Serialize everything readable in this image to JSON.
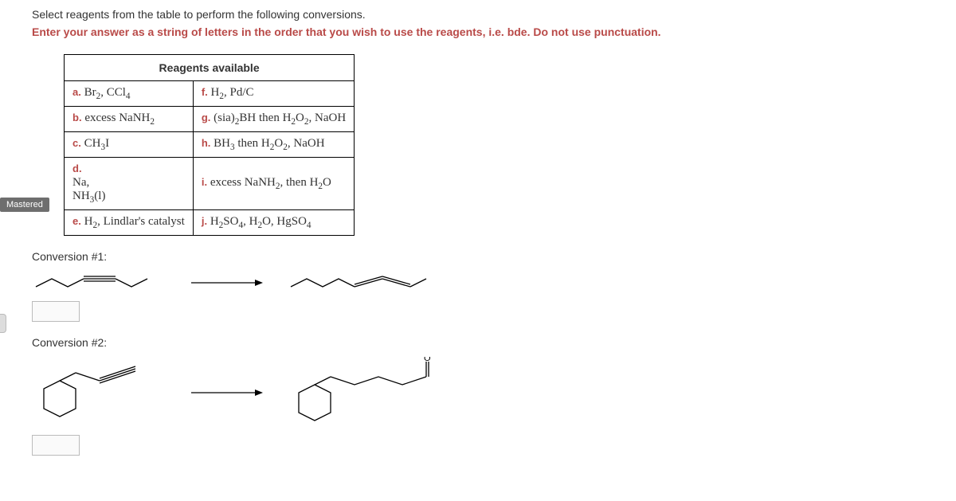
{
  "instructions": {
    "line1": "Select reagents from the table to perform the following conversions.",
    "line2": "Enter your answer as a string of letters in the order that you wish to use the reagents, i.e. bde. Do not use punctuation."
  },
  "table": {
    "header": "Reagents available",
    "rows": [
      {
        "left_label": "a.",
        "left_text": "Br₂, CCl₄",
        "right_label": "f.",
        "right_text": "H₂, Pd/C"
      },
      {
        "left_label": "b.",
        "left_text": "excess NaNH₂",
        "right_label": "g.",
        "right_text": "(sia)₂BH then H₂O₂, NaOH"
      },
      {
        "left_label": "c.",
        "left_text": "CH₃I",
        "right_label": "h.",
        "right_text": "BH₃ then H₂O₂, NaOH"
      },
      {
        "left_label": "d.",
        "left_text": "Na, NH₃(l)",
        "right_label": "i.",
        "right_text": "excess NaNH₂, then H₂O"
      },
      {
        "left_label": "e.",
        "left_text": "H₂, Lindlar's catalyst",
        "right_label": "j.",
        "right_text": "H₂SO₄, H₂O, HgSO₄"
      }
    ]
  },
  "mastered_label": "Mastered",
  "conversions": {
    "c1_label": "Conversion #1:",
    "c2_label": "Conversion #2:"
  }
}
